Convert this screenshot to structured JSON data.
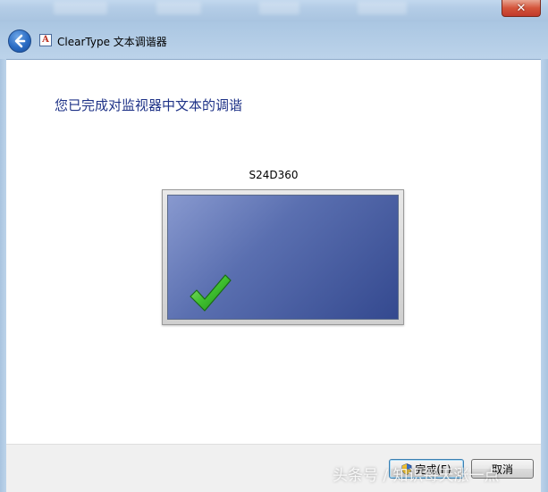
{
  "window": {
    "title": "ClearType 文本调谐器",
    "close_label": "✕"
  },
  "icons": {
    "back": "back-arrow-icon",
    "app": "cleartype-icon",
    "check": "checkmark-icon",
    "shield": "uac-shield-icon"
  },
  "app_icon_letter": "A",
  "main": {
    "heading": "您已完成对监视器中文本的调谐",
    "monitor_name": "S24D360"
  },
  "footer": {
    "finish_label": "完成(F)",
    "cancel_label": "取消"
  },
  "watermark": "头条号 / 知识每天涨一点",
  "colors": {
    "heading": "#1e3287",
    "screen_start": "#8899cf",
    "screen_end": "#34498f",
    "check": "#3fbf2f"
  }
}
